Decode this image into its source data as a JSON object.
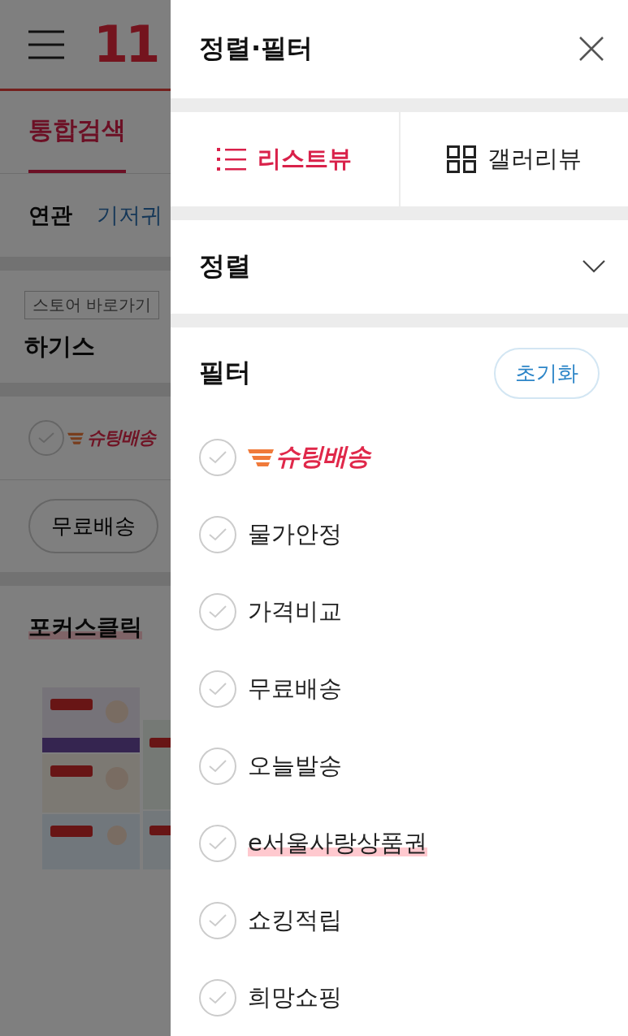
{
  "background_page": {
    "logo": "11",
    "tabs": [
      {
        "label": "통합검색",
        "selected": true
      }
    ],
    "related": {
      "label": "연관",
      "keywords": [
        "기저귀"
      ]
    },
    "store_link": "스토어 바로가기",
    "brand": "하기스",
    "shooting_filter": {
      "label": "슈팅배송",
      "checked": false
    },
    "chips": [
      "무료배송"
    ],
    "focus_click": {
      "title": "포커스클릭",
      "highlighted": true
    }
  },
  "drawer": {
    "title": "정렬·필터",
    "views": [
      {
        "label": "리스트뷰",
        "kind": "list",
        "selected": true
      },
      {
        "label": "갤러리뷰",
        "kind": "grid",
        "selected": false
      }
    ],
    "sort": {
      "label": "정렬",
      "expanded": false
    },
    "filter": {
      "label": "필터",
      "reset": "초기화",
      "options": [
        {
          "label": "슈팅배송",
          "kind": "logo",
          "checked": false,
          "highlighted": false
        },
        {
          "label": "물가안정",
          "kind": "text",
          "checked": false,
          "highlighted": false
        },
        {
          "label": "가격비교",
          "kind": "text",
          "checked": false,
          "highlighted": false
        },
        {
          "label": "무료배송",
          "kind": "text",
          "checked": false,
          "highlighted": false
        },
        {
          "label": "오늘발송",
          "kind": "text",
          "checked": false,
          "highlighted": false
        },
        {
          "label": "e서울사랑상품권",
          "kind": "text",
          "checked": false,
          "highlighted": true
        },
        {
          "label": "쇼킹적립",
          "kind": "text",
          "checked": false,
          "highlighted": false
        },
        {
          "label": "희망쇼핑",
          "kind": "text",
          "checked": false,
          "highlighted": false
        }
      ]
    }
  }
}
